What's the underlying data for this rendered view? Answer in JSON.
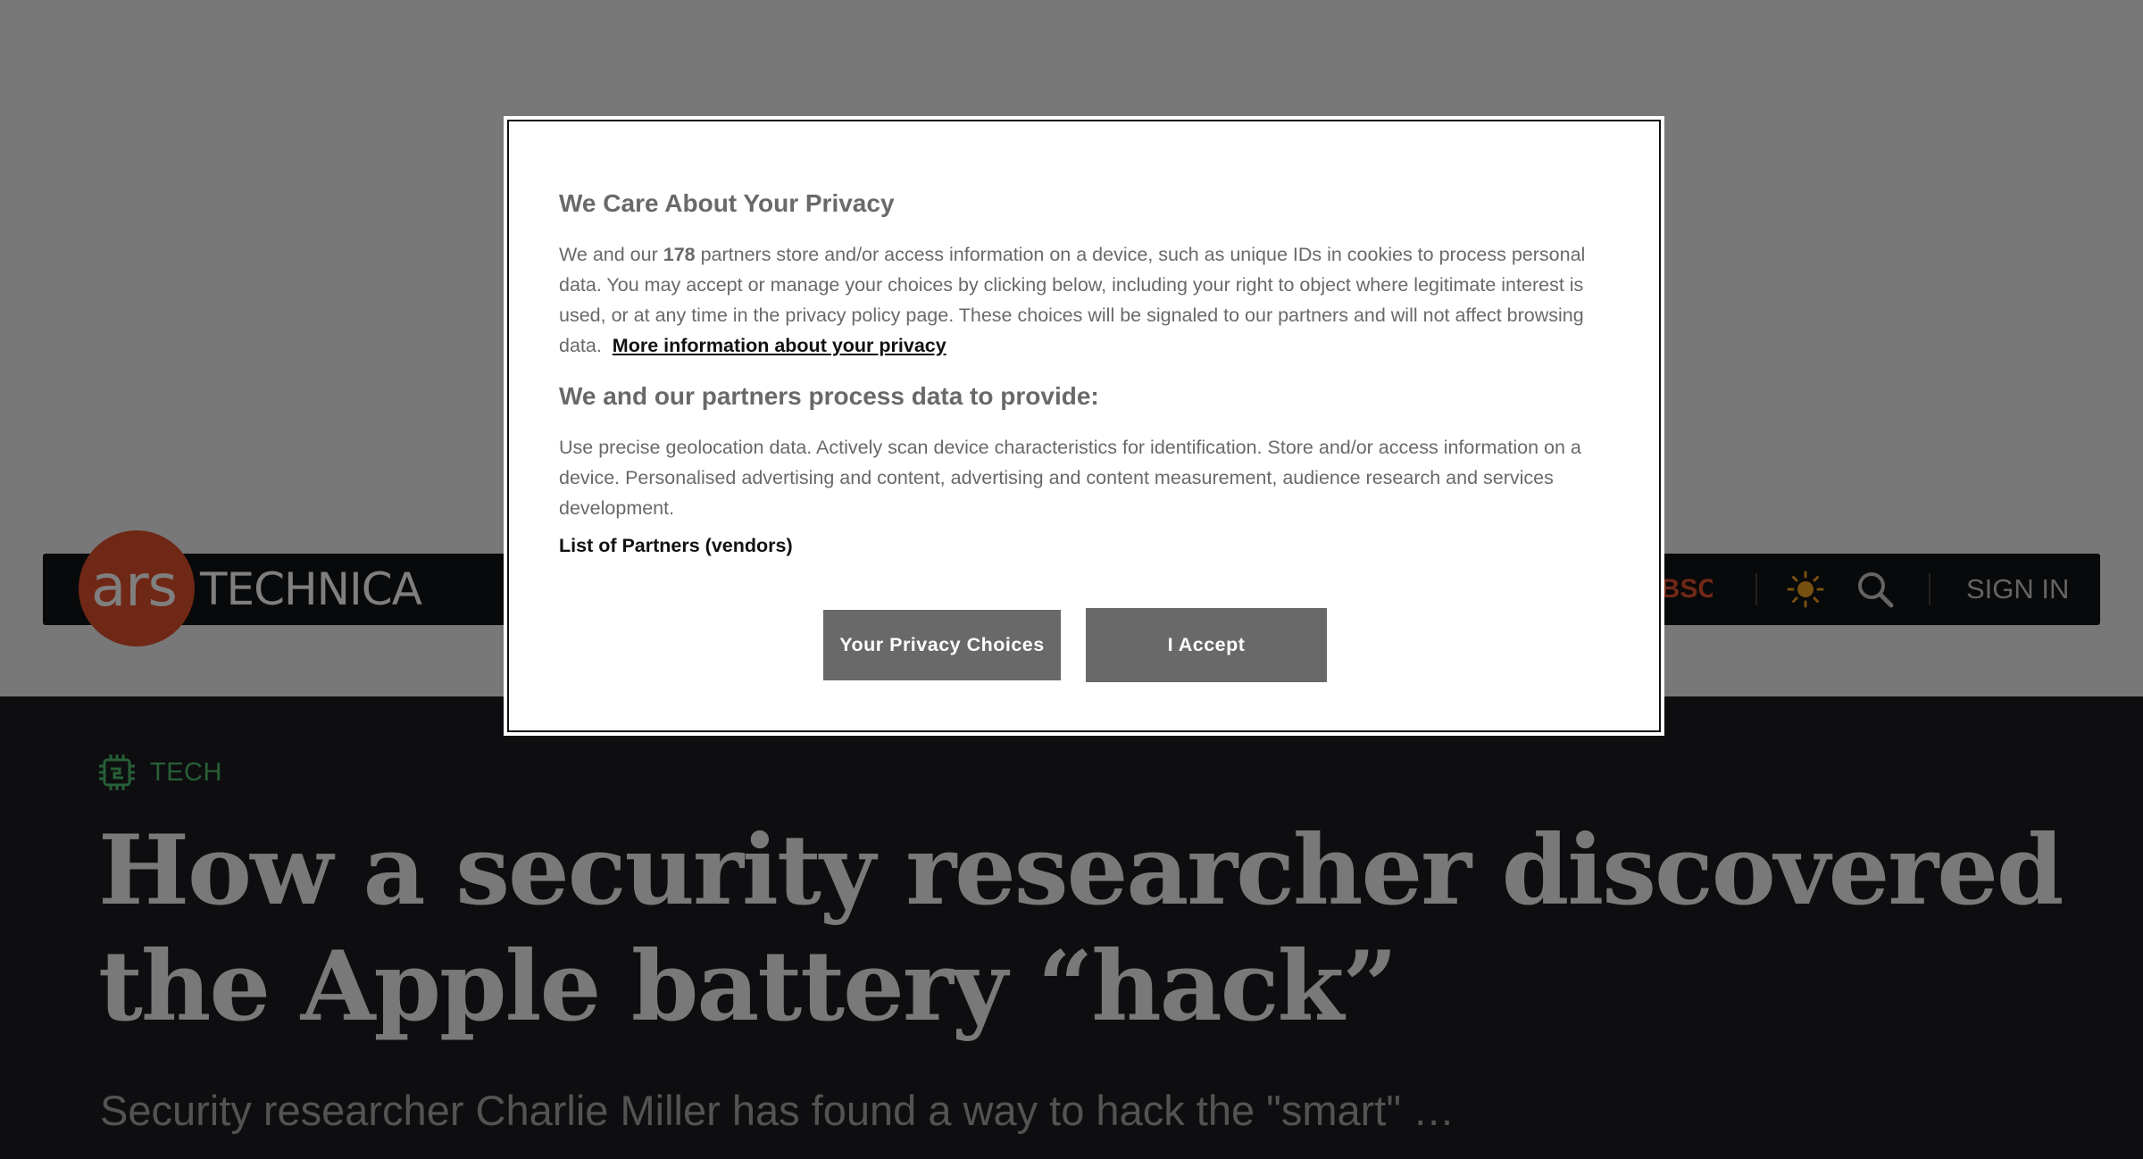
{
  "header": {
    "logo_ars": "ars",
    "logo_technica": "TECHNICA",
    "subscribe_label": "SUBSCRIBE",
    "signin_label": "SIGN IN"
  },
  "article": {
    "category": "TECH",
    "headline": "How a security researcher discovered the Apple battery “hack”",
    "dek": "Security researcher Charlie Miller has found a way to hack the \"smart\" …"
  },
  "consent": {
    "title": "We Care About Your Privacy",
    "body_prefix": "We and our ",
    "partner_count": "178",
    "body_suffix": " partners store and/or access information on a device, such as unique IDs in cookies to process personal data. You may accept or manage your choices by clicking below, including your right to object where legitimate interest is used, or at any time in the privacy policy page. These choices will be signaled to our partners and will not affect browsing data.",
    "more_info_link": "More information about your privacy",
    "subtitle": "We and our partners process data to provide:",
    "purposes": "Use precise geolocation data. Actively scan device characteristics for identification. Store and/or access information on a device. Personalised advertising and content, advertising and content measurement, audience research and services development.",
    "vendors_link": "List of Partners (vendors)",
    "choices_button": "Your Privacy Choices",
    "accept_button": "I Accept"
  },
  "icons": {
    "theme_toggle": "sun-icon",
    "search": "search-icon",
    "category": "chip-icon"
  },
  "colors": {
    "brand_orange": "#e0512d",
    "header_bg": "#111214",
    "article_bg": "#1c1d20",
    "category_green": "#4fbf6e",
    "button_gray": "#696969"
  }
}
